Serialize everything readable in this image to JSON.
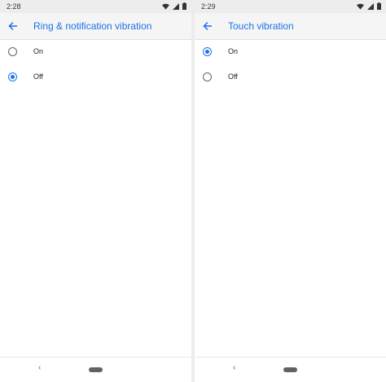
{
  "screens": [
    {
      "status": {
        "time": "2:28"
      },
      "title": "Ring & notification vibration",
      "options": [
        {
          "label": "On",
          "checked": false
        },
        {
          "label": "Off",
          "checked": true
        }
      ]
    },
    {
      "status": {
        "time": "2:29"
      },
      "title": "Touch vibration",
      "options": [
        {
          "label": "On",
          "checked": true
        },
        {
          "label": "Off",
          "checked": false
        }
      ]
    }
  ],
  "icons": {
    "back": "arrow-back-icon",
    "wifi": "wifi-icon",
    "signal": "cell-signal-icon",
    "battery": "battery-icon",
    "nav_back": "nav-back-icon",
    "nav_home": "nav-home-pill"
  },
  "colors": {
    "accent": "#1a73e8",
    "status_bar": "#ededed",
    "app_bar": "#f5f5f5"
  }
}
